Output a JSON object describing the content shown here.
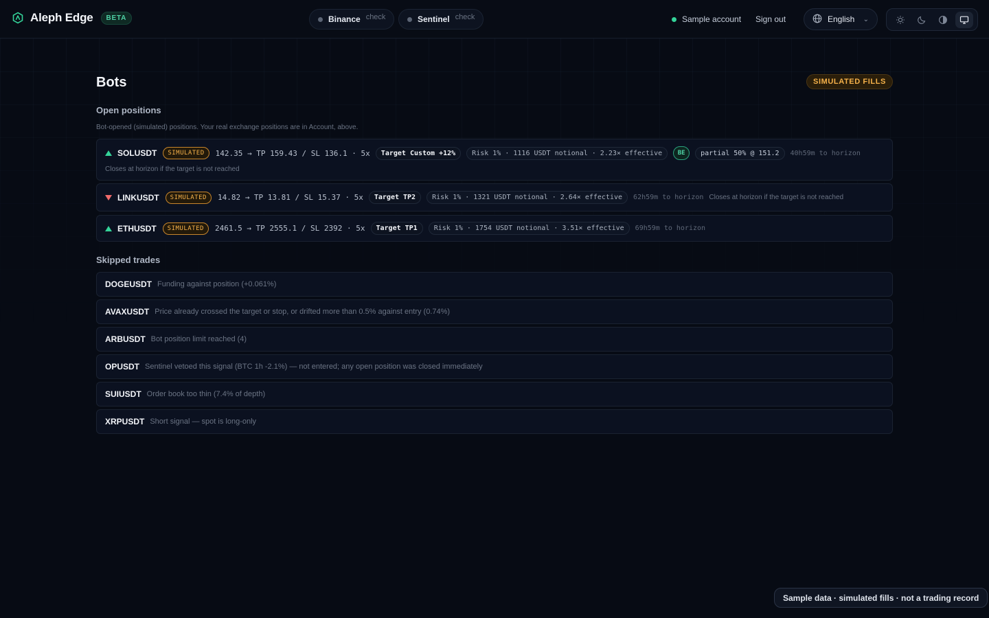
{
  "app": {
    "name": "Aleph Edge",
    "badge": "BETA"
  },
  "header": {
    "binance": {
      "name": "Binance",
      "state": "check"
    },
    "sentinel": {
      "name": "Sentinel",
      "state": "check"
    },
    "account_label": "Sample account",
    "signout_label": "Sign out",
    "language": "English",
    "theme_options": [
      "light-icon",
      "dark-icon",
      "contrast-icon",
      "system-icon"
    ],
    "theme_active": "system"
  },
  "page": {
    "title": "Bots",
    "sim_badge": "SIMULATED FILLS"
  },
  "open_positions": {
    "title": "Open positions",
    "subtitle": "Bot-opened (simulated) positions. Your real exchange positions are in Account, above.",
    "rows": [
      {
        "direction": "long",
        "symbol": "SOLUSDT",
        "tag": "SIMULATED",
        "levels": "142.35 → TP 159.43 / SL 136.1 · 5x",
        "target": "Target Custom +12%",
        "risk": "Risk 1% · 1116 USDT notional · 2.23× effective",
        "be": "BE",
        "partial": "partial 50% @ 151.2",
        "horizon": "40h59m to horizon",
        "note": "Closes at horizon if the target is not reached"
      },
      {
        "direction": "short",
        "symbol": "LINKUSDT",
        "tag": "SIMULATED",
        "levels": "14.82 → TP 13.81 / SL 15.37 · 5x",
        "target": "Target TP2",
        "risk": "Risk 1% · 1321 USDT notional · 2.64× effective",
        "horizon": "62h59m to horizon",
        "note": "Closes at horizon if the target is not reached"
      },
      {
        "direction": "long",
        "symbol": "ETHUSDT",
        "tag": "SIMULATED",
        "levels": "2461.5 → TP 2555.1 / SL 2392 · 5x",
        "target": "Target TP1",
        "risk": "Risk 1% · 1754 USDT notional · 3.51× effective",
        "horizon": "69h59m to horizon"
      }
    ]
  },
  "skipped": {
    "title": "Skipped trades",
    "rows": [
      {
        "symbol": "DOGEUSDT",
        "reason": "Funding against position (+0.061%)"
      },
      {
        "symbol": "AVAXUSDT",
        "reason": "Price already crossed the target or stop, or drifted more than 0.5% against entry (0.74%)"
      },
      {
        "symbol": "ARBUSDT",
        "reason": "Bot position limit reached (4)"
      },
      {
        "symbol": "OPUSDT",
        "reason": "Sentinel vetoed this signal (BTC 1h -2.1%) — not entered; any open position was closed immediately"
      },
      {
        "symbol": "SUIUSDT",
        "reason": "Order book too thin (7.4% of depth)"
      },
      {
        "symbol": "XRPUSDT",
        "reason": "Short signal — spot is long-only"
      }
    ]
  },
  "footer": {
    "note": "Sample data · simulated fills · not a trading record"
  },
  "colors": {
    "background": "#070b14",
    "accent": "#34d399",
    "warning": "#f5b14a",
    "short": "#f06a6a"
  }
}
